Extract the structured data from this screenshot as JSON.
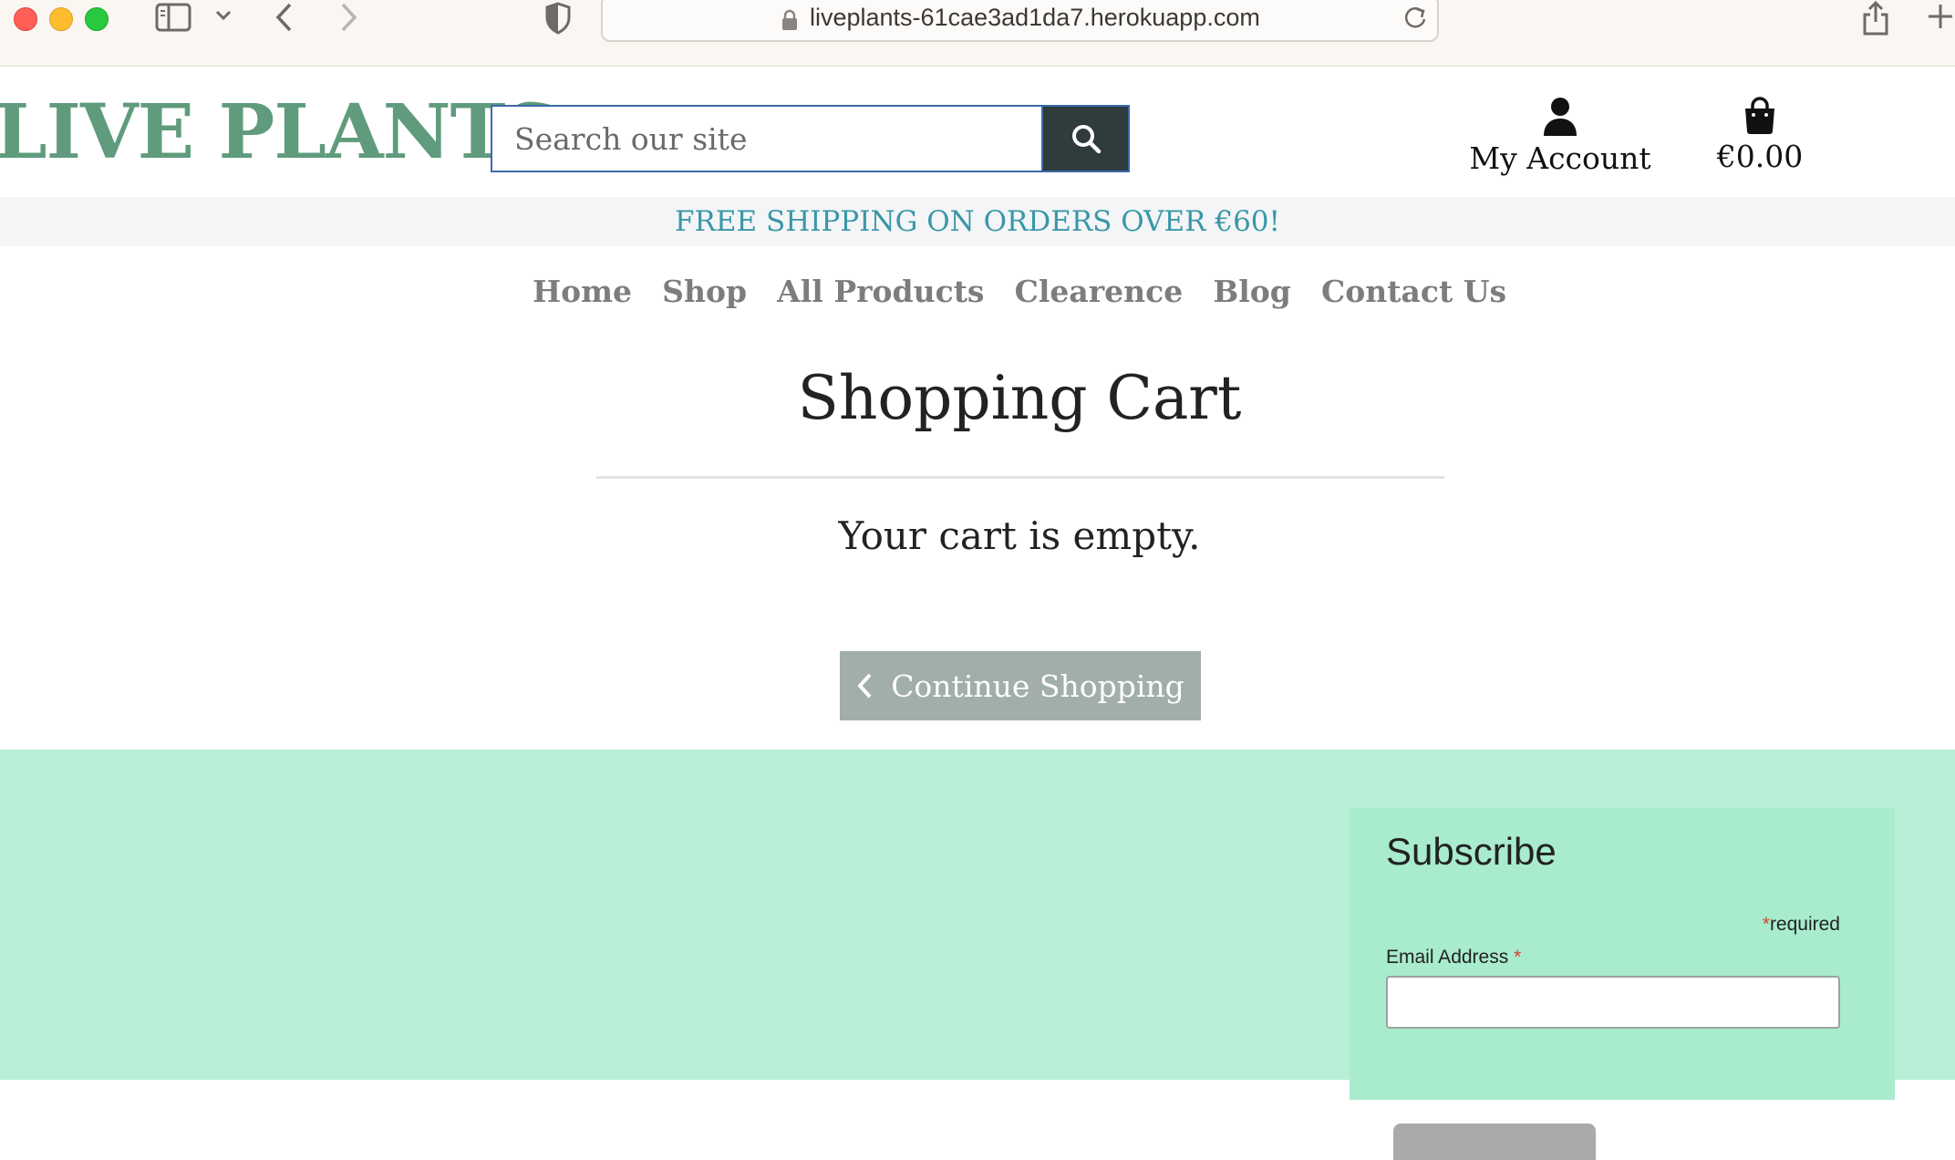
{
  "browser": {
    "url": "liveplants-61cae3ad1da7.herokuapp.com"
  },
  "header": {
    "logo": "LIVE PLANTS",
    "search_placeholder": "Search our site",
    "account_label": "My Account",
    "cart_total": "€0.00"
  },
  "banner": {
    "text": "FREE SHIPPING ON ORDERS OVER €60!"
  },
  "nav": {
    "items": [
      "Home",
      "Shop",
      "All Products",
      "Clearence",
      "Blog",
      "Contact Us"
    ]
  },
  "main": {
    "title": "Shopping Cart",
    "empty_message": "Your cart is empty.",
    "continue_label": "Continue Shopping"
  },
  "footer": {
    "subscribe_title": "Subscribe",
    "required_asterisk": "*",
    "required_text": "required",
    "email_label": "Email Address",
    "email_asterisk": "*"
  },
  "colors": {
    "brand_green": "#5f9b7c",
    "banner_text": "#3a97a7",
    "footer_bg": "#b8efd6",
    "search_button": "#2f3b3c"
  },
  "icons": {
    "search": "search-icon",
    "account": "user-icon",
    "cart": "shopping-bag-icon",
    "continue": "chevron-left-icon"
  }
}
